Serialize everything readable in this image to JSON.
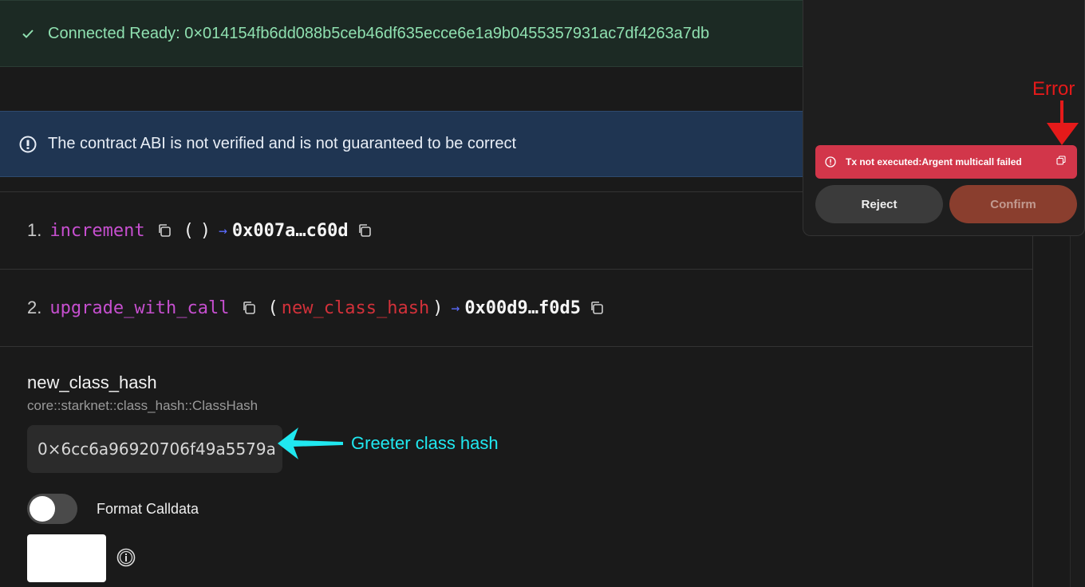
{
  "banner_success": {
    "text": "Connected Ready: 0×014154fb6dd088b5ceb46df635ecce6e1a9b0455357931ac7df4263a7db"
  },
  "banner_warning": {
    "text": "The contract ABI is not verified and is not guaranteed to be correct"
  },
  "functions": [
    {
      "index": "1.",
      "name": "increment",
      "open_paren": "(",
      "param": "",
      "close_paren": ")",
      "arrow": "→",
      "return": "0x007a…c60d"
    },
    {
      "index": "2.",
      "name": "upgrade_with_call",
      "open_paren": "(",
      "param": "new_class_hash",
      "close_paren": ")",
      "arrow": "→",
      "return": "0x00d9…f0d5"
    }
  ],
  "param_form": {
    "label": "new_class_hash",
    "type": "core::starknet::class_hash::ClassHash",
    "value": "0×6cc6a96920706f49a5579a",
    "toggle_label": "Format Calldata"
  },
  "annotation": {
    "text": "Greeter class hash"
  },
  "wallet_popup": {
    "error_label": "Error",
    "error_message": "Tx not executed:Argent multicall failed",
    "reject_label": "Reject",
    "confirm_label": "Confirm"
  },
  "colors": {
    "accent_function": "#c64fcf",
    "accent_param": "#d2313a",
    "success_text": "#8fe0b0",
    "error_bg": "#d2364a",
    "annotation": "#20e8f0"
  }
}
